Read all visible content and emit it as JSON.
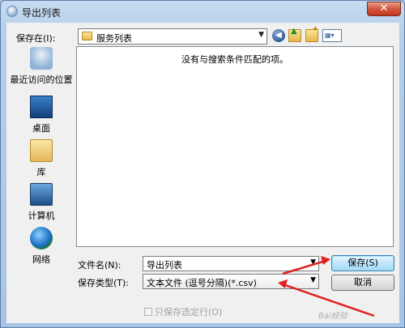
{
  "window": {
    "title": "导出列表",
    "close_glyph": "✕"
  },
  "toolbar": {
    "save_in_label": "保存在(I):",
    "location": "服务列表",
    "back_glyph": "◀",
    "view_glyph": "▦▾"
  },
  "places": [
    {
      "label": "最近访问的位置",
      "icon": "recent-places-icon"
    },
    {
      "label": "桌面",
      "icon": "desktop-icon"
    },
    {
      "label": "库",
      "icon": "library-icon"
    },
    {
      "label": "计算机",
      "icon": "computer-icon"
    },
    {
      "label": "网络",
      "icon": "network-icon"
    }
  ],
  "file_list": {
    "empty_message": "没有与搜索条件匹配的项。"
  },
  "form": {
    "file_name_label": "文件名(N):",
    "file_name_value": "导出列表",
    "save_type_label": "保存类型(T):",
    "save_type_value": "文本文件 (逗号分隔)(*.csv)",
    "save_button": "保存(S)",
    "cancel_button": "取消",
    "save_selected_only": "只保存选定行(O)"
  },
  "annotation": {
    "arrow_color": "#e02020"
  },
  "watermark": "Bai经验"
}
